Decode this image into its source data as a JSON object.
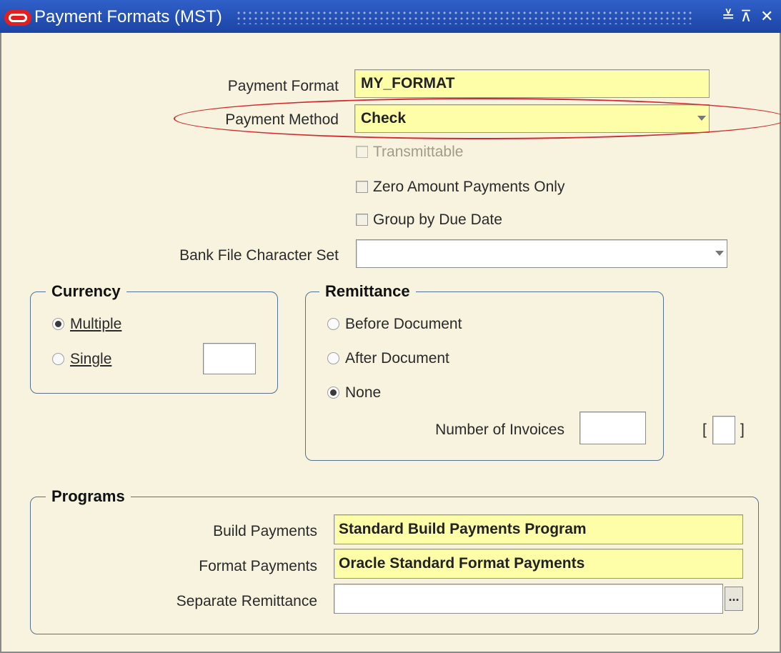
{
  "window": {
    "title": "Payment Formats (MST)",
    "controls": {
      "minimize": "≚",
      "maximize": "⊼",
      "close": "✕"
    }
  },
  "header": {
    "payment_format_label": "Payment Format",
    "payment_format_value": "MY_FORMAT",
    "payment_method_label": "Payment Method",
    "payment_method_value": "Check",
    "transmittable_label": "Transmittable",
    "transmittable_checked": false,
    "transmittable_enabled": false,
    "zero_amount_label": "Zero Amount Payments Only",
    "zero_amount_checked": false,
    "group_by_due_label": "Group by Due Date",
    "group_by_due_checked": false,
    "bank_file_charset_label": "Bank File Character Set",
    "bank_file_charset_value": ""
  },
  "currency": {
    "title": "Currency",
    "options": [
      {
        "label": "Multiple",
        "selected": true
      },
      {
        "label": "Single",
        "selected": false
      }
    ],
    "single_value": ""
  },
  "remittance": {
    "title": "Remittance",
    "options": [
      {
        "label": "Before Document",
        "selected": false
      },
      {
        "label": "After Document",
        "selected": false
      },
      {
        "label": "None",
        "selected": true
      }
    ],
    "number_of_invoices_label": "Number of Invoices",
    "number_of_invoices_value": ""
  },
  "programs": {
    "title": "Programs",
    "build_payments_label": "Build Payments",
    "build_payments_value": "Standard Build Payments Program",
    "format_payments_label": "Format Payments",
    "format_payments_value": "Oracle Standard Format Payments",
    "separate_remittance_label": "Separate Remittance",
    "separate_remittance_value": "",
    "lov_button_label": "..."
  },
  "colors": {
    "titlebar": "#2f60c8",
    "background": "#f7f3df",
    "required_field": "#fefda8",
    "annotation_ellipse": "#d42a2a",
    "group_border": "#566f94"
  },
  "icons": {
    "oracle_logo": "oracle-logo-icon",
    "dropdown": "chevron-down-icon",
    "lov": "ellipsis-icon"
  }
}
